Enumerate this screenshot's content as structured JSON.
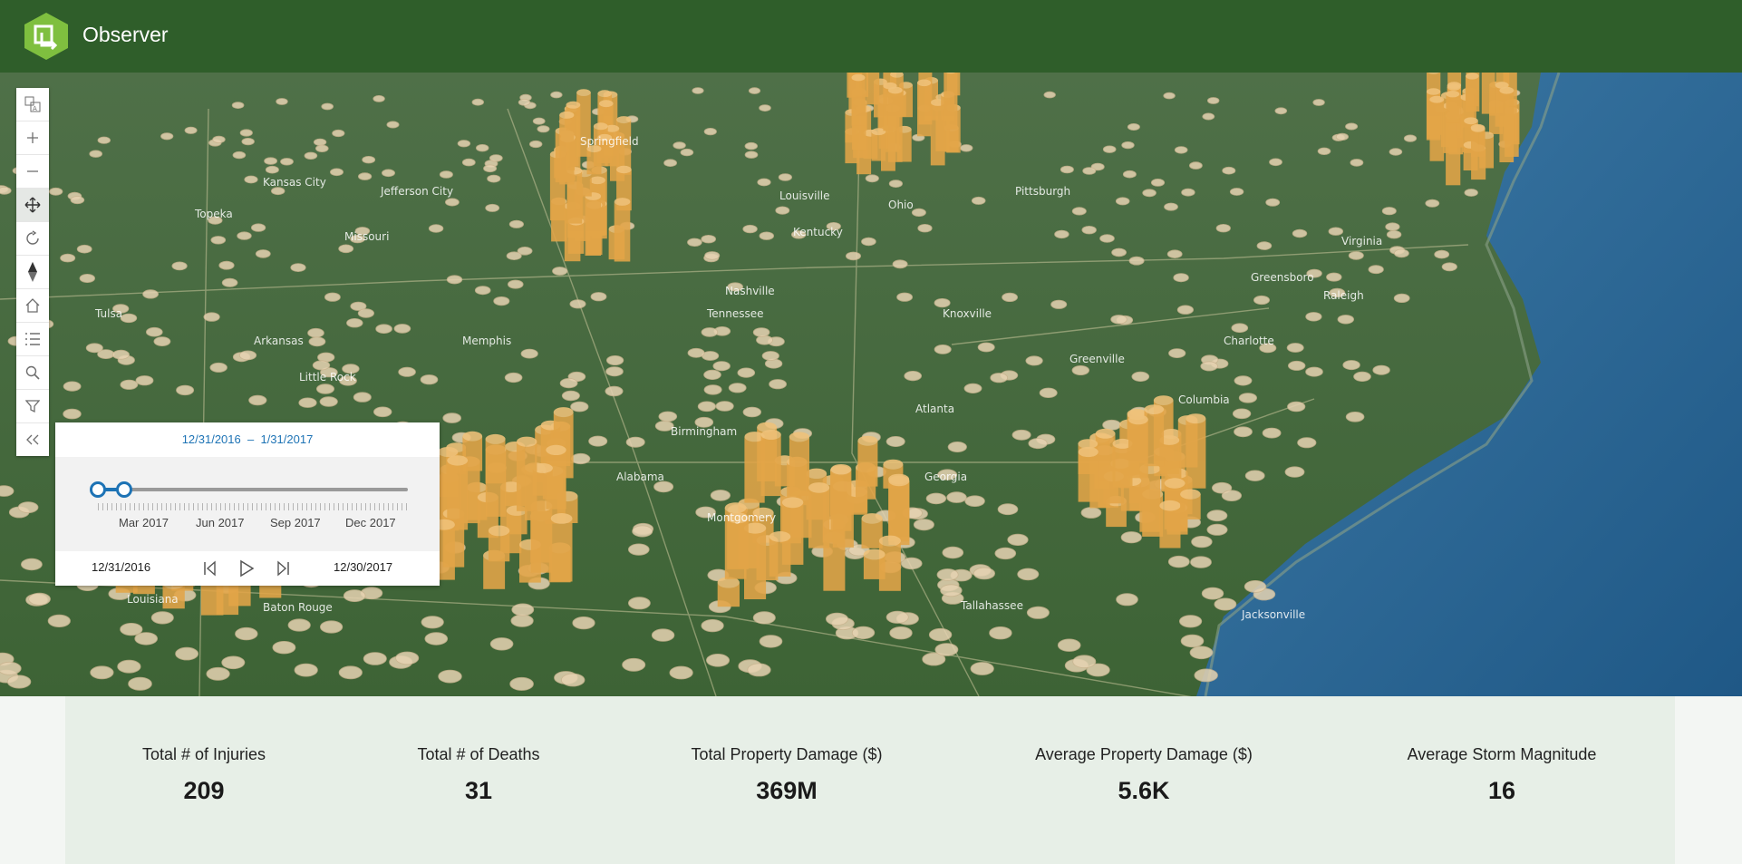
{
  "app": {
    "title": "Observer"
  },
  "toolbar": {
    "tools": [
      {
        "name": "basemap-toggle-icon"
      },
      {
        "name": "zoom-in-icon"
      },
      {
        "name": "zoom-out-icon"
      },
      {
        "name": "pan-icon"
      },
      {
        "name": "rotate-icon"
      },
      {
        "name": "compass-icon"
      },
      {
        "name": "home-icon"
      },
      {
        "name": "layer-list-icon"
      },
      {
        "name": "search-icon"
      },
      {
        "name": "filter-icon"
      },
      {
        "name": "collapse-icon"
      }
    ]
  },
  "map": {
    "labels": [
      "Kansas City",
      "Topeka",
      "Jefferson City",
      "Springfield",
      "Missouri",
      "Louisville",
      "Kentucky",
      "Nashville",
      "Tennessee",
      "Memphis",
      "Arkansas",
      "Little Rock",
      "Tulsa",
      "Birmingham",
      "Alabama",
      "Montgomery",
      "Atlanta",
      "Georgia",
      "Columbia",
      "Charlotte",
      "Greenville",
      "Knoxville",
      "Raleigh",
      "Greensboro",
      "Pittsburgh",
      "Ohio",
      "Virginia",
      "Louisiana",
      "Baton Rouge",
      "Tallahassee",
      "Jacksonville"
    ],
    "colors": {
      "tall_column": "#e3a548",
      "short_disc": "#e6d3b2",
      "ocean": "#2e6c98",
      "land": "#466d3c"
    }
  },
  "time_slider": {
    "range_start": "12/31/2016",
    "range_separator": "–",
    "range_end": "1/31/2017",
    "ticks": [
      "Mar 2017",
      "Jun 2017",
      "Sep 2017",
      "Dec 2017"
    ],
    "min_date": "12/31/2016",
    "max_date": "12/30/2017",
    "accent": "#1d73b5"
  },
  "stats": [
    {
      "label": "Total # of Injuries",
      "value": "209"
    },
    {
      "label": "Total # of Deaths",
      "value": "31"
    },
    {
      "label": "Total Property Damage ($)",
      "value": "369M"
    },
    {
      "label": "Average Property Damage ($)",
      "value": "5.6K"
    },
    {
      "label": "Average Storm Magnitude",
      "value": "16"
    }
  ]
}
